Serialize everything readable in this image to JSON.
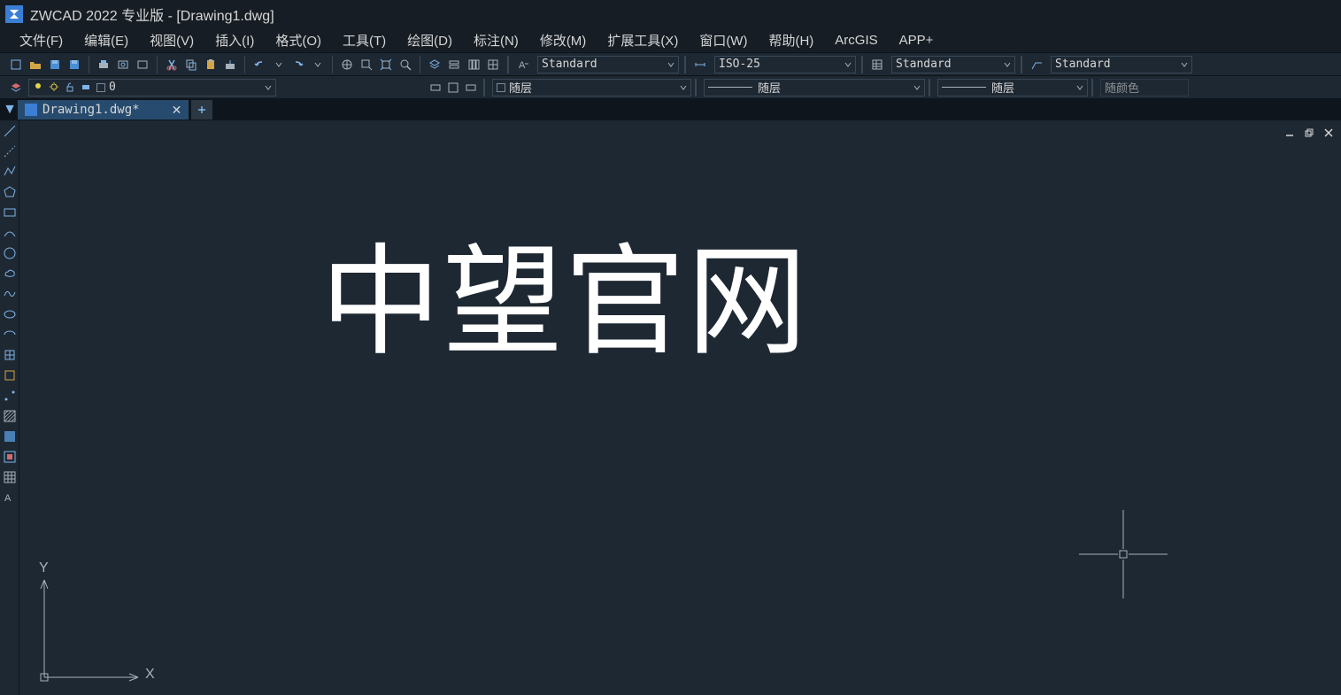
{
  "title": "ZWCAD 2022 专业版 - [Drawing1.dwg]",
  "menu": [
    "文件(F)",
    "编辑(E)",
    "视图(V)",
    "插入(I)",
    "格式(O)",
    "工具(T)",
    "绘图(D)",
    "标注(N)",
    "修改(M)",
    "扩展工具(X)",
    "窗口(W)",
    "帮助(H)",
    "ArcGIS",
    "APP+"
  ],
  "layer_value": "0",
  "text_style": "Standard",
  "dim_style": "ISO-25",
  "table_style": "Standard",
  "mleader_style": "Standard",
  "bylayer1": "随层",
  "bylayer2": "随层",
  "bylayer3": "随层",
  "bycolor": "随颜色",
  "tab_name": "Drawing1.dwg*",
  "canvas_text": "中望官网",
  "axis_y": "Y",
  "axis_x": "X"
}
